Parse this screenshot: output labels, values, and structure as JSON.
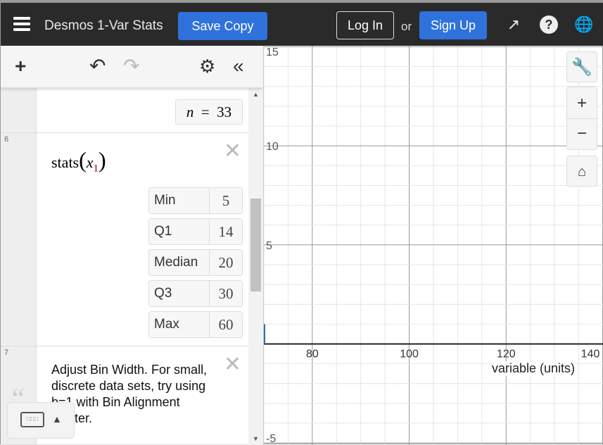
{
  "header": {
    "menu_icon": "hamburger-icon",
    "title": "Desmos 1-Var Stats",
    "save_label": "Save Copy",
    "login_label": "Log In",
    "or_label": "or",
    "signup_label": "Sign Up",
    "icons": [
      "share-icon",
      "help-icon",
      "globe-icon"
    ]
  },
  "toolbar": {
    "icons": [
      "plus-icon",
      "undo-icon",
      "redo-icon",
      "gear-icon",
      "collapse-icon"
    ]
  },
  "expressions": [
    {
      "index": "",
      "result_var": "n",
      "result_op": "=",
      "result_value": "33"
    },
    {
      "index": "6",
      "latex_fn": "stats",
      "latex_var": "x",
      "latex_sub": "1",
      "stats": [
        {
          "label": "Min",
          "value": "5"
        },
        {
          "label": "Q1",
          "value": "14"
        },
        {
          "label": "Median",
          "value": "20"
        },
        {
          "label": "Q3",
          "value": "30"
        },
        {
          "label": "Max",
          "value": "60"
        }
      ]
    },
    {
      "index": "7",
      "note": "Adjust Bin Width.  For small, discrete data sets, try using b=1 with Bin Alignment Center."
    }
  ],
  "graph": {
    "xlabel": "variable (units)",
    "xlim": [
      70,
      140
    ],
    "ylim": [
      -5.1,
      15.05
    ],
    "x_ticks": [
      80,
      100,
      120,
      140
    ],
    "y_ticks": [
      15,
      10,
      5,
      -5
    ],
    "x_major_step": 20,
    "x_minor_step": 5,
    "y_major_step": 5,
    "y_minor_step": 1,
    "accent": "#2d70b3",
    "controls": [
      "wrench-icon",
      "zoom-in-icon",
      "zoom-out-icon",
      "home-icon"
    ]
  },
  "colors": {
    "topbar": "#2a2a2a",
    "button": "#2f72dc"
  }
}
